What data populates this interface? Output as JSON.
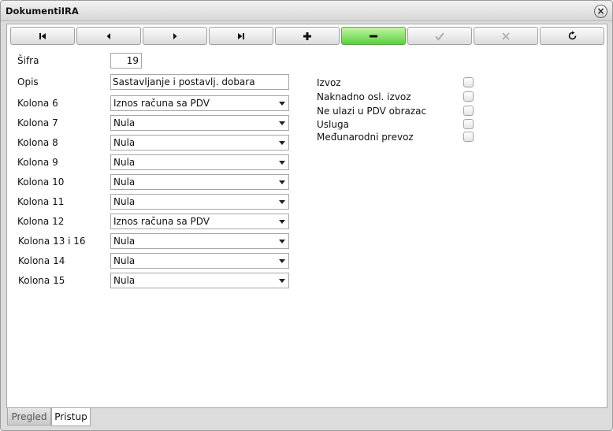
{
  "window": {
    "title": "DokumentiIRA"
  },
  "toolbar": {
    "buttons": [
      {
        "name": "first-record",
        "icon": "first-icon",
        "state": "enabled"
      },
      {
        "name": "previous-record",
        "icon": "prev-icon",
        "state": "enabled"
      },
      {
        "name": "next-record",
        "icon": "next-icon",
        "state": "enabled"
      },
      {
        "name": "last-record",
        "icon": "last-icon",
        "state": "enabled"
      },
      {
        "name": "add-record",
        "icon": "plus-icon",
        "state": "enabled"
      },
      {
        "name": "delete-record",
        "icon": "minus-icon",
        "state": "active"
      },
      {
        "name": "confirm",
        "icon": "check-icon",
        "state": "disabled"
      },
      {
        "name": "cancel",
        "icon": "x-icon",
        "state": "disabled"
      },
      {
        "name": "refresh",
        "icon": "refresh-icon",
        "state": "enabled"
      }
    ],
    "active_color": "#58d13a"
  },
  "form": {
    "sifra": {
      "label": "Šifra",
      "value": "19"
    },
    "opis": {
      "label": "Opis",
      "value": "Sastavljanje i postavlj. dobara"
    },
    "columns": [
      {
        "label": "Kolona 6",
        "value": "Iznos računa sa PDV"
      },
      {
        "label": "Kolona 7",
        "value": "Nula"
      },
      {
        "label": "Kolona 8",
        "value": "Nula"
      },
      {
        "label": "Kolona 9",
        "value": "Nula"
      },
      {
        "label": "Kolona 10",
        "value": "Nula"
      },
      {
        "label": "Kolona 11",
        "value": "Nula"
      },
      {
        "label": "Kolona 12",
        "value": "Iznos računa sa PDV"
      },
      {
        "label": "Kolona 13 i 16",
        "value": "Nula"
      },
      {
        "label": "Kolona 14",
        "value": "Nula"
      },
      {
        "label": "Kolona 15",
        "value": "Nula"
      }
    ],
    "checkboxes": [
      {
        "label": "Izvoz",
        "checked": false
      },
      {
        "label": "Naknadno osl. izvoz",
        "checked": false
      },
      {
        "label": "Ne ulazi u PDV obrazac",
        "checked": false
      },
      {
        "label": "Usluga",
        "checked": false
      },
      {
        "label": "Međunarodni prevoz",
        "checked": false
      }
    ]
  },
  "tabs": [
    {
      "label": "Pregled",
      "active": false
    },
    {
      "label": "Pristup",
      "active": true
    }
  ]
}
